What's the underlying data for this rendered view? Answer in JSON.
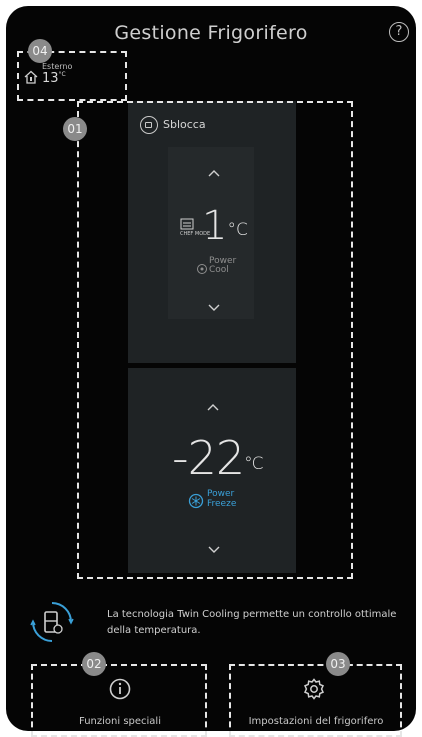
{
  "header": {
    "title": "Gestione Frigorifero",
    "help_label": "?"
  },
  "outside": {
    "label": "Esterno",
    "value": "13",
    "unit": "°C"
  },
  "fridge": {
    "unlock_label": "Sblocca",
    "mode_text": "CHEF MODE",
    "temperature": "1",
    "unit": "°C",
    "feature": [
      "Power",
      "Cool"
    ]
  },
  "freezer": {
    "temperature": "-22",
    "unit": "°C",
    "feature": [
      "Power",
      "Freeze"
    ]
  },
  "info": {
    "text": "La tecnologia Twin Cooling permette un controllo ottimale della temperatura."
  },
  "buttons": {
    "special_label": "Funzioni speciali",
    "settings_label": "Impostazioni del frigorifero"
  },
  "badges": {
    "b01": "01",
    "b02": "02",
    "b03": "03",
    "b04": "04"
  },
  "colors": {
    "background": "#050505",
    "panel": "#1f2325",
    "accent": "#3aa0d8",
    "badge": "#8a8a8a"
  }
}
